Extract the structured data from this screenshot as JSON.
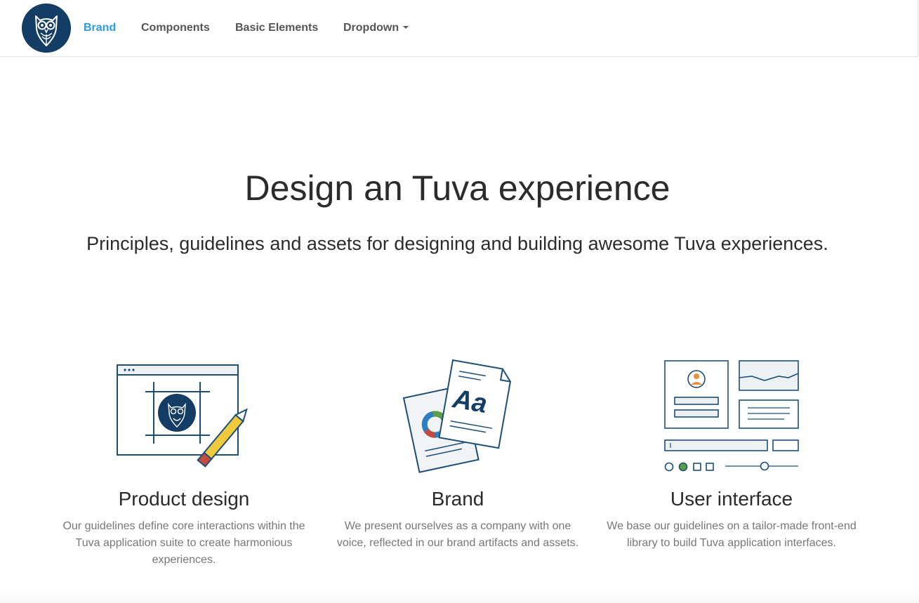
{
  "nav": {
    "items": [
      {
        "label": "Brand",
        "active": true
      },
      {
        "label": "Components",
        "active": false
      },
      {
        "label": "Basic Elements",
        "active": false
      },
      {
        "label": "Dropdown",
        "active": false,
        "has_caret": true
      }
    ],
    "logo_icon": "owl-logo-icon"
  },
  "hero": {
    "title": "Design an Tuva experience",
    "subtitle": "Principles, guidelines and assets for designing and building awesome Tuva experiences."
  },
  "features": [
    {
      "icon": "product-design-illustration",
      "title": "Product design",
      "description": "Our guidelines define core interactions within the Tuva application suite to create harmonious experiences."
    },
    {
      "icon": "brand-illustration",
      "title": "Brand",
      "description": "We present ourselves as a company with one voice, reflected in our brand artifacts and assets.",
      "glyph": "Aa"
    },
    {
      "icon": "user-interface-illustration",
      "title": "User interface",
      "description": "We base our guidelines on a tailor-made front-end library to build Tuva application interfaces."
    }
  ],
  "colors": {
    "brand_navy": "#143d66",
    "nav_active": "#2d9be0",
    "nav_text": "#555555",
    "line": "#1c4e7c",
    "pencil_yellow": "#f0c93c",
    "pencil_red": "#c44c3e",
    "accent_orange": "#e8913a",
    "accent_green": "#5a9e45"
  }
}
